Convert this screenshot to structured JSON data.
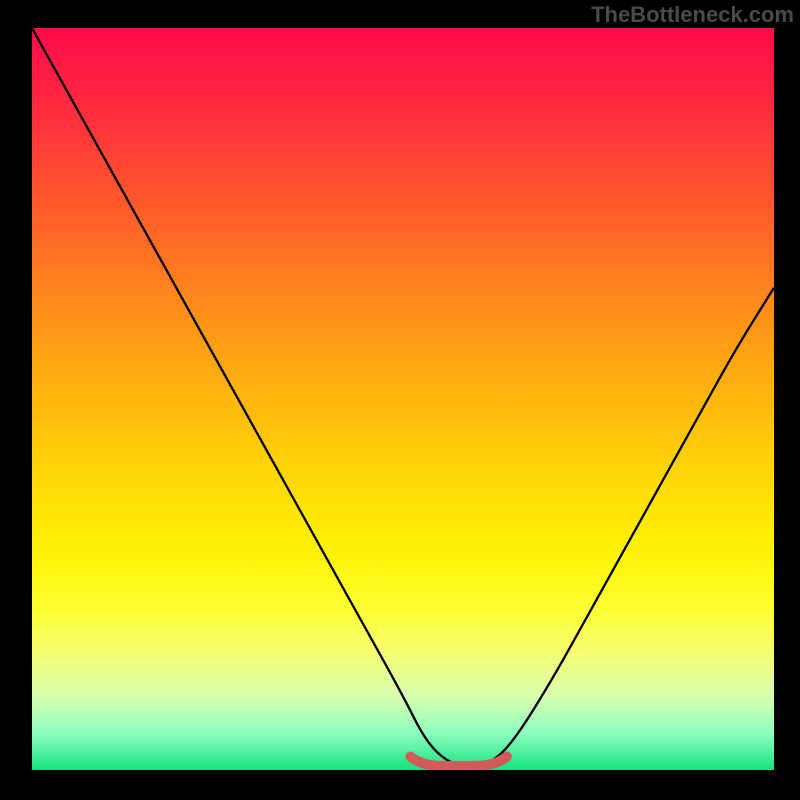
{
  "watermark": "TheBottleneck.com",
  "chart_data": {
    "type": "line",
    "title": "",
    "xlabel": "",
    "ylabel": "",
    "xlim": [
      0,
      100
    ],
    "ylim": [
      0,
      100
    ],
    "grid": false,
    "legend": false,
    "series": [
      {
        "name": "curve",
        "x": [
          0,
          5,
          10,
          15,
          20,
          25,
          30,
          35,
          40,
          45,
          50,
          53,
          56,
          59,
          62,
          65,
          70,
          75,
          80,
          85,
          90,
          95,
          100
        ],
        "y": [
          100,
          91,
          82,
          73,
          64,
          55,
          46,
          37,
          28,
          19,
          10,
          4,
          1,
          0.5,
          1,
          4,
          12,
          21,
          30,
          39,
          48,
          57,
          65
        ]
      }
    ],
    "highlight_range": {
      "x_start": 51,
      "x_end": 64,
      "y": 1
    }
  }
}
